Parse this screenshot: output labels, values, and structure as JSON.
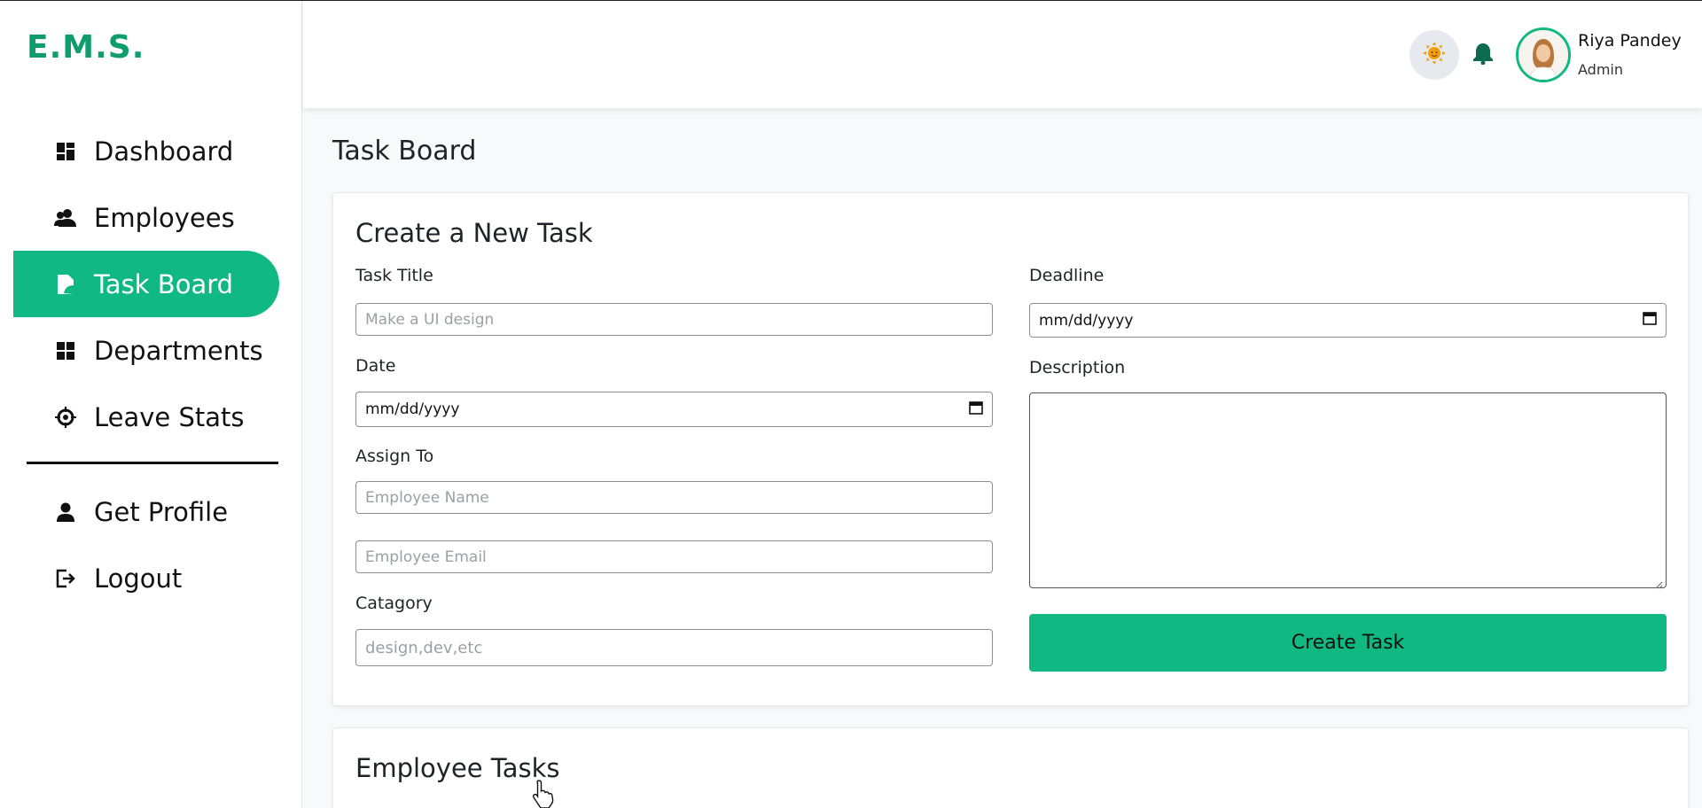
{
  "brand": {
    "logo": "E.M.S.",
    "accent": "#10b981"
  },
  "sidebar": {
    "items": [
      {
        "label": "Dashboard",
        "icon": "dashboard-icon"
      },
      {
        "label": "Employees",
        "icon": "users-icon"
      },
      {
        "label": "Task Board",
        "icon": "task-icon",
        "active": true
      },
      {
        "label": "Departments",
        "icon": "grid-icon"
      },
      {
        "label": "Leave Stats",
        "icon": "crosshair-icon"
      }
    ],
    "secondary": [
      {
        "label": "Get Profile",
        "icon": "user-icon"
      },
      {
        "label": "Logout",
        "icon": "logout-icon"
      }
    ]
  },
  "header": {
    "theme_icon": "sun-icon",
    "bell_icon": "bell-icon",
    "user": {
      "name": "Riya Pandey",
      "role": "Admin"
    }
  },
  "page": {
    "title": "Task Board"
  },
  "form": {
    "title": "Create a New Task",
    "task_title": {
      "label": "Task Title",
      "placeholder": "Make a UI design"
    },
    "date": {
      "label": "Date",
      "value": "mm/dd/yyyy"
    },
    "assign_to": {
      "label": "Assign To",
      "name_placeholder": "Employee Name",
      "email_placeholder": "Employee Email"
    },
    "category": {
      "label": "Catagory",
      "placeholder": "design,dev,etc"
    },
    "deadline": {
      "label": "Deadline",
      "value": "mm/dd/yyyy"
    },
    "description": {
      "label": "Description"
    },
    "submit_label": "Create Task"
  },
  "tasks_section": {
    "title": "Employee Tasks"
  }
}
